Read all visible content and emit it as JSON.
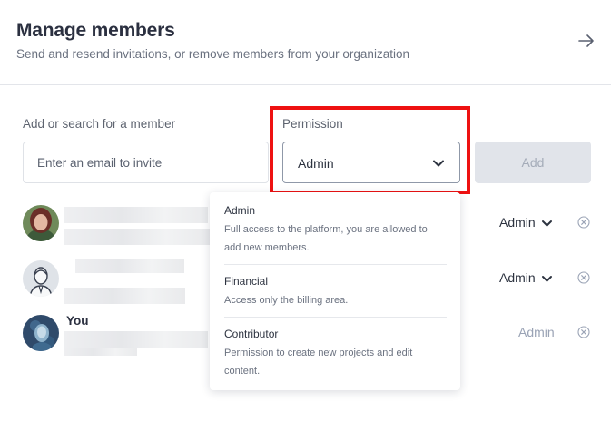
{
  "header": {
    "title": "Manage members",
    "subtitle": "Send and resend invitations, or remove members from your organization",
    "close_icon": "arrow-right-icon"
  },
  "invite": {
    "member_label": "Add or search for a member",
    "email_placeholder": "Enter an email to invite",
    "email_value": "",
    "permission_label": "Permission",
    "permission_value": "Admin",
    "add_label": "Add",
    "add_enabled": false
  },
  "permission_options": [
    {
      "title": "Admin",
      "description": "Full access to the platform, you are allowed to add new members."
    },
    {
      "title": "Financial",
      "description": "Access only the billing area."
    },
    {
      "title": "Contributor",
      "description": "Permission to create new projects and edit content."
    }
  ],
  "members": [
    {
      "name": "",
      "role": "Admin",
      "role_editable": true
    },
    {
      "name": "",
      "role": "Admin",
      "role_editable": true
    },
    {
      "name": "You",
      "role": "Admin",
      "role_editable": false
    }
  ],
  "colors": {
    "highlight": "#ee1111",
    "disabled_button": "#e1e4ea",
    "disabled_text": "#9aa3b5"
  }
}
